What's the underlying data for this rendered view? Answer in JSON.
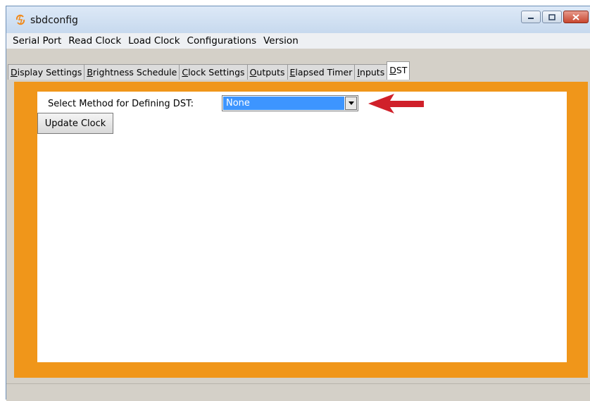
{
  "window": {
    "title": "sbdconfig"
  },
  "menu": [
    "Serial Port",
    "Read Clock",
    "Load Clock",
    "Configurations",
    "Version"
  ],
  "tabs": [
    {
      "u": "D",
      "rest": "isplay Settings"
    },
    {
      "u": "B",
      "rest": "rightness Schedule"
    },
    {
      "u": "C",
      "rest": "lock Settings"
    },
    {
      "u": "O",
      "rest": "utputs"
    },
    {
      "u": "E",
      "rest": "lapsed Timer"
    },
    {
      "u": "I",
      "rest": "nputs"
    },
    {
      "u": "D",
      "rest": "ST"
    }
  ],
  "active_tab": 6,
  "dst": {
    "label": "Select Method for Defining DST:",
    "selected": "None"
  },
  "buttons": {
    "update_clock": "Update Clock"
  },
  "colors": {
    "content_background": "#f0961a",
    "select_highlight": "#3d95ff",
    "annotation_arrow": "#d0202a"
  }
}
